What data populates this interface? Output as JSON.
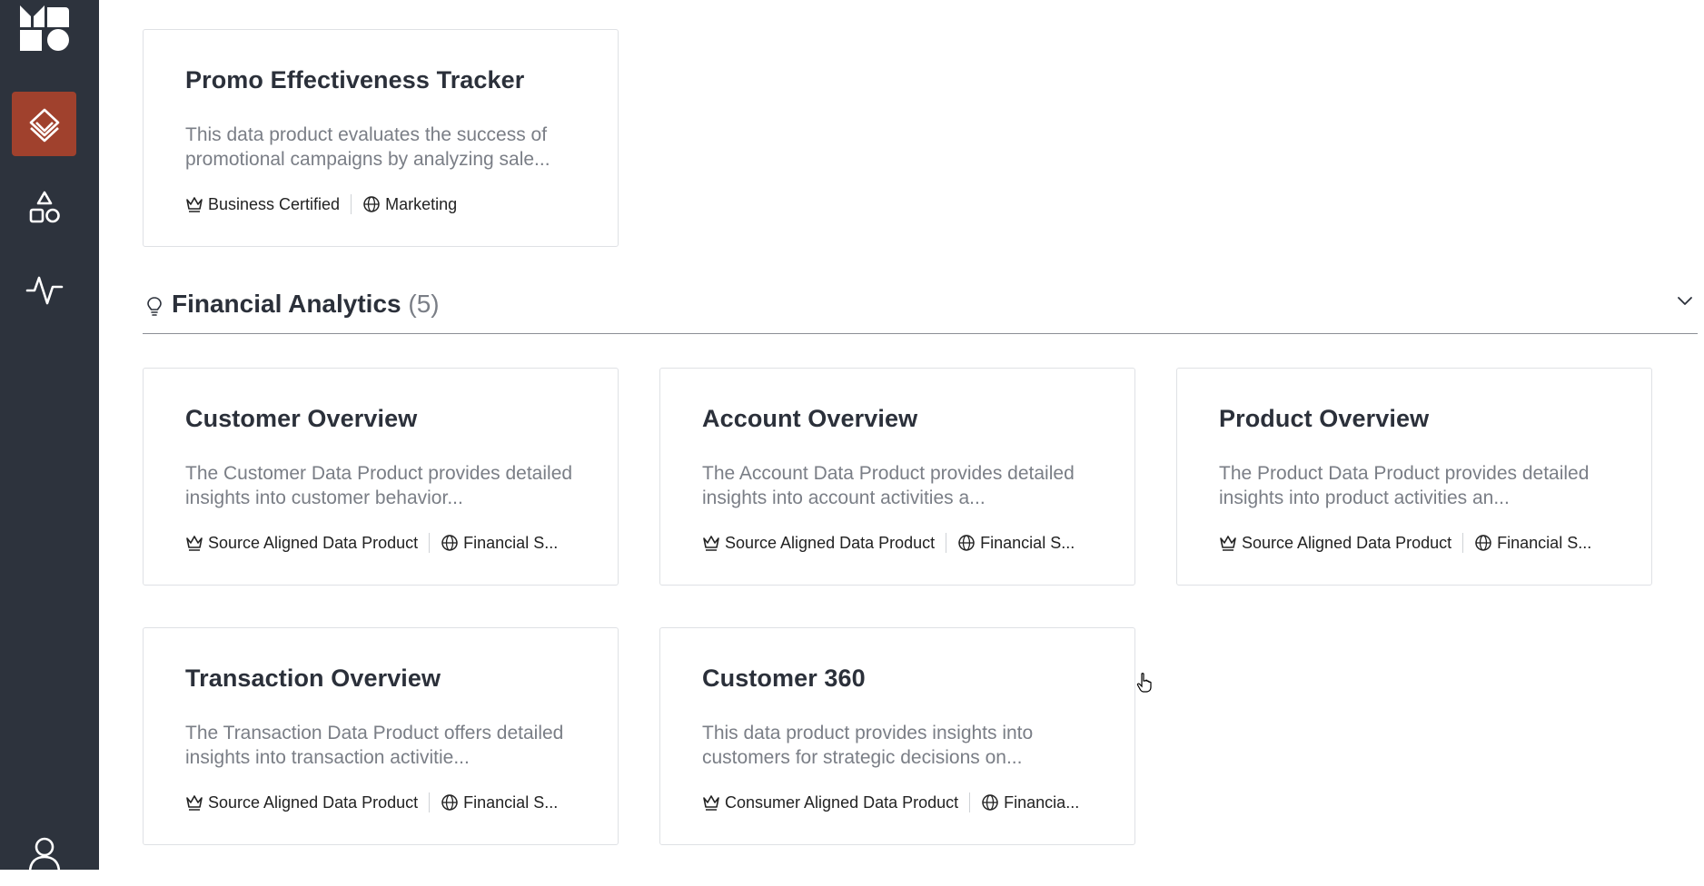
{
  "sidebar": {
    "items": [
      {
        "icon": "data-products-icon",
        "active": true
      },
      {
        "icon": "shapes-icon",
        "active": false
      },
      {
        "icon": "activity-icon",
        "active": false
      }
    ],
    "user_icon": "user-icon",
    "accent": "#a0412d",
    "background": "#2d333d"
  },
  "top_card": {
    "title": "Promo Effectiveness Tracker",
    "description": "This data product evaluates the success of promotional campaigns by analyzing sale...",
    "type_tag": "Business Certified",
    "domain_tag": "Marketing"
  },
  "section": {
    "title": "Financial Analytics",
    "count": "(5)"
  },
  "cards": [
    {
      "title": "Customer Overview",
      "description": "The Customer Data Product provides detailed insights into customer behavior...",
      "type_tag": "Source Aligned Data Product",
      "domain_tag": "Financial S..."
    },
    {
      "title": "Account Overview",
      "description": "The Account Data Product provides detailed insights into account activities a...",
      "type_tag": "Source Aligned Data Product",
      "domain_tag": "Financial S..."
    },
    {
      "title": "Product Overview",
      "description": "The Product Data Product provides detailed insights into product activities an...",
      "type_tag": "Source Aligned Data Product",
      "domain_tag": "Financial S..."
    },
    {
      "title": "Transaction Overview",
      "description": "The Transaction Data Product offers detailed insights into transaction activitie...",
      "type_tag": "Source Aligned Data Product",
      "domain_tag": "Financial S..."
    },
    {
      "title": "Customer 360",
      "description": "This data product provides insights into customers for strategic decisions on...",
      "type_tag": "Consumer Aligned Data Product",
      "domain_tag": "Financia..."
    }
  ]
}
